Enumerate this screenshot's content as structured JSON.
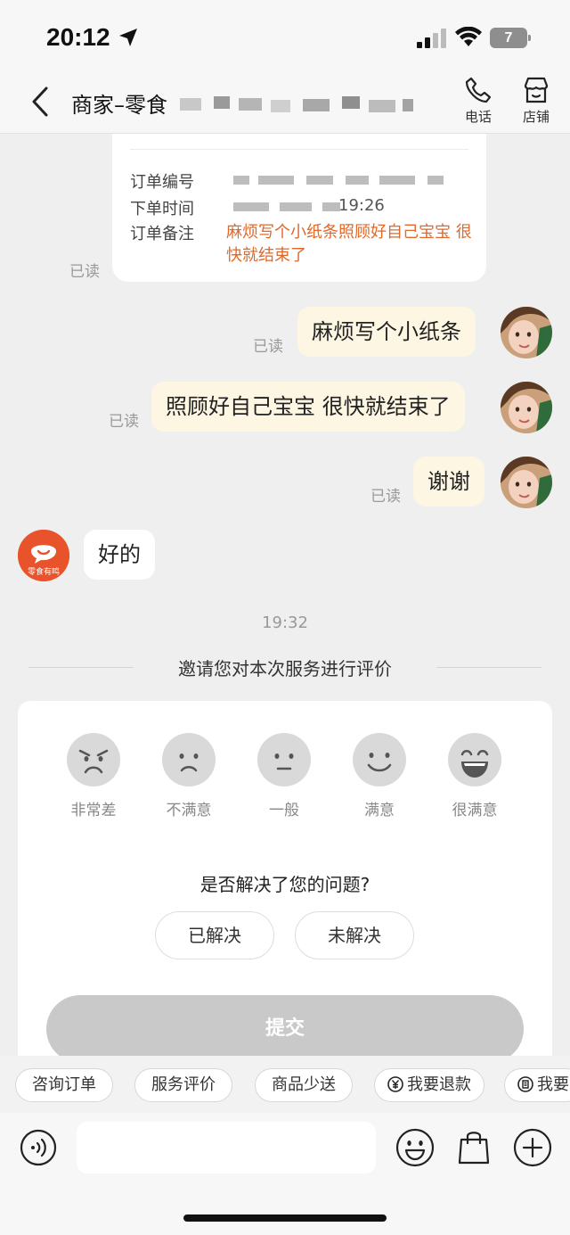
{
  "status_bar": {
    "time": "20:12",
    "battery": "7",
    "icons": [
      "location-arrow-icon",
      "cellular-signal-icon",
      "wifi-icon",
      "battery-icon"
    ]
  },
  "header": {
    "title": "商家–零食",
    "actions": [
      {
        "label": "电话",
        "icon": "phone-icon"
      },
      {
        "label": "店铺",
        "icon": "store-icon"
      }
    ]
  },
  "order_card": {
    "order_no_label": "订单编号",
    "order_time_label": "下单时间",
    "order_time_visible_suffix": "19:26",
    "note_label": "订单备注",
    "note": "麻烦写个小纸条照顾好自己宝宝 很快就结束了"
  },
  "messages": [
    {
      "side": "right",
      "text": "麻烦写个小纸条",
      "read": "已读"
    },
    {
      "side": "right",
      "text": "照顾好自己宝宝 很快就结束了",
      "read": "已读"
    },
    {
      "side": "right",
      "text": "谢谢",
      "read": "已读"
    },
    {
      "side": "left",
      "text": "好的"
    }
  ],
  "card_read": "已读",
  "shop_avatar_text": "零食有鸣",
  "timestamp": "19:32",
  "rating": {
    "invite": "邀请您对本次服务进行评价",
    "faces": [
      {
        "label": "非常差",
        "icon": "very-bad-face-icon"
      },
      {
        "label": "不满意",
        "icon": "unsatisfied-face-icon"
      },
      {
        "label": "一般",
        "icon": "neutral-face-icon"
      },
      {
        "label": "满意",
        "icon": "satisfied-face-icon"
      },
      {
        "label": "很满意",
        "icon": "very-satisfied-face-icon"
      }
    ],
    "question": "是否解决了您的问题?",
    "resolved": "已解决",
    "unresolved": "未解决",
    "submit": "提交"
  },
  "quick_replies": [
    "咨询订单",
    "服务评价",
    "商品少送",
    "我要退款",
    "我要"
  ],
  "input": {
    "placeholder": "",
    "icons": [
      "voice-icon",
      "emoji-icon",
      "shopping-bag-icon",
      "plus-icon"
    ]
  },
  "colors": {
    "accent": "#e0682a",
    "bubble_self": "#fdf6e3",
    "background": "#efefef",
    "submit_disabled": "#c9c9c9"
  }
}
